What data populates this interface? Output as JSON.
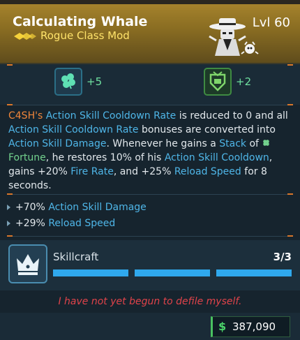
{
  "header": {
    "title": "Calculating Whale",
    "subtitle": "Rogue Class Mod",
    "level": "Lvl 60"
  },
  "stats": [
    {
      "icon": "clover-icon",
      "value": "+5"
    },
    {
      "icon": "shield-icon",
      "value": "+2"
    }
  ],
  "description": {
    "p1": "C4SH's",
    "p2": " ",
    "p3": "Action Skill Cooldown Rate",
    "p4": " is reduced to 0 and all ",
    "p5": "Action Skill Cooldown Rate",
    "p6": " bonuses are converted into ",
    "p7": "Action Skill Damage",
    "p8": ". Whenever he gains a ",
    "p9": "Stack",
    "p10": " of ",
    "p11": "Fortune",
    "p12": ", he restores 10% of his ",
    "p13": "Action Skill Cooldown",
    "p14": ", gains +20% ",
    "p15": "Fire Rate",
    "p16": ", and +25% ",
    "p17": "Reload Speed",
    "p18": " for 8 seconds."
  },
  "bullets": [
    {
      "amount": "+70%",
      "label": "Action Skill Damage"
    },
    {
      "amount": "+29%",
      "label": "Reload Speed"
    }
  ],
  "skillcraft": {
    "label": "Skillcraft",
    "count": "3/3",
    "progress": 1.0
  },
  "quote": "I have not yet begun to defile myself.",
  "price": {
    "symbol": "$",
    "amount": "387,090"
  },
  "colors": {
    "rarity_gold": "#a9862e",
    "highlight_blue": "#4fb6e8",
    "highlight_orange": "#f0863a",
    "fortune_green": "#73d28e",
    "quote_red": "#e0434a",
    "skill_bar": "#2fa9ee"
  }
}
